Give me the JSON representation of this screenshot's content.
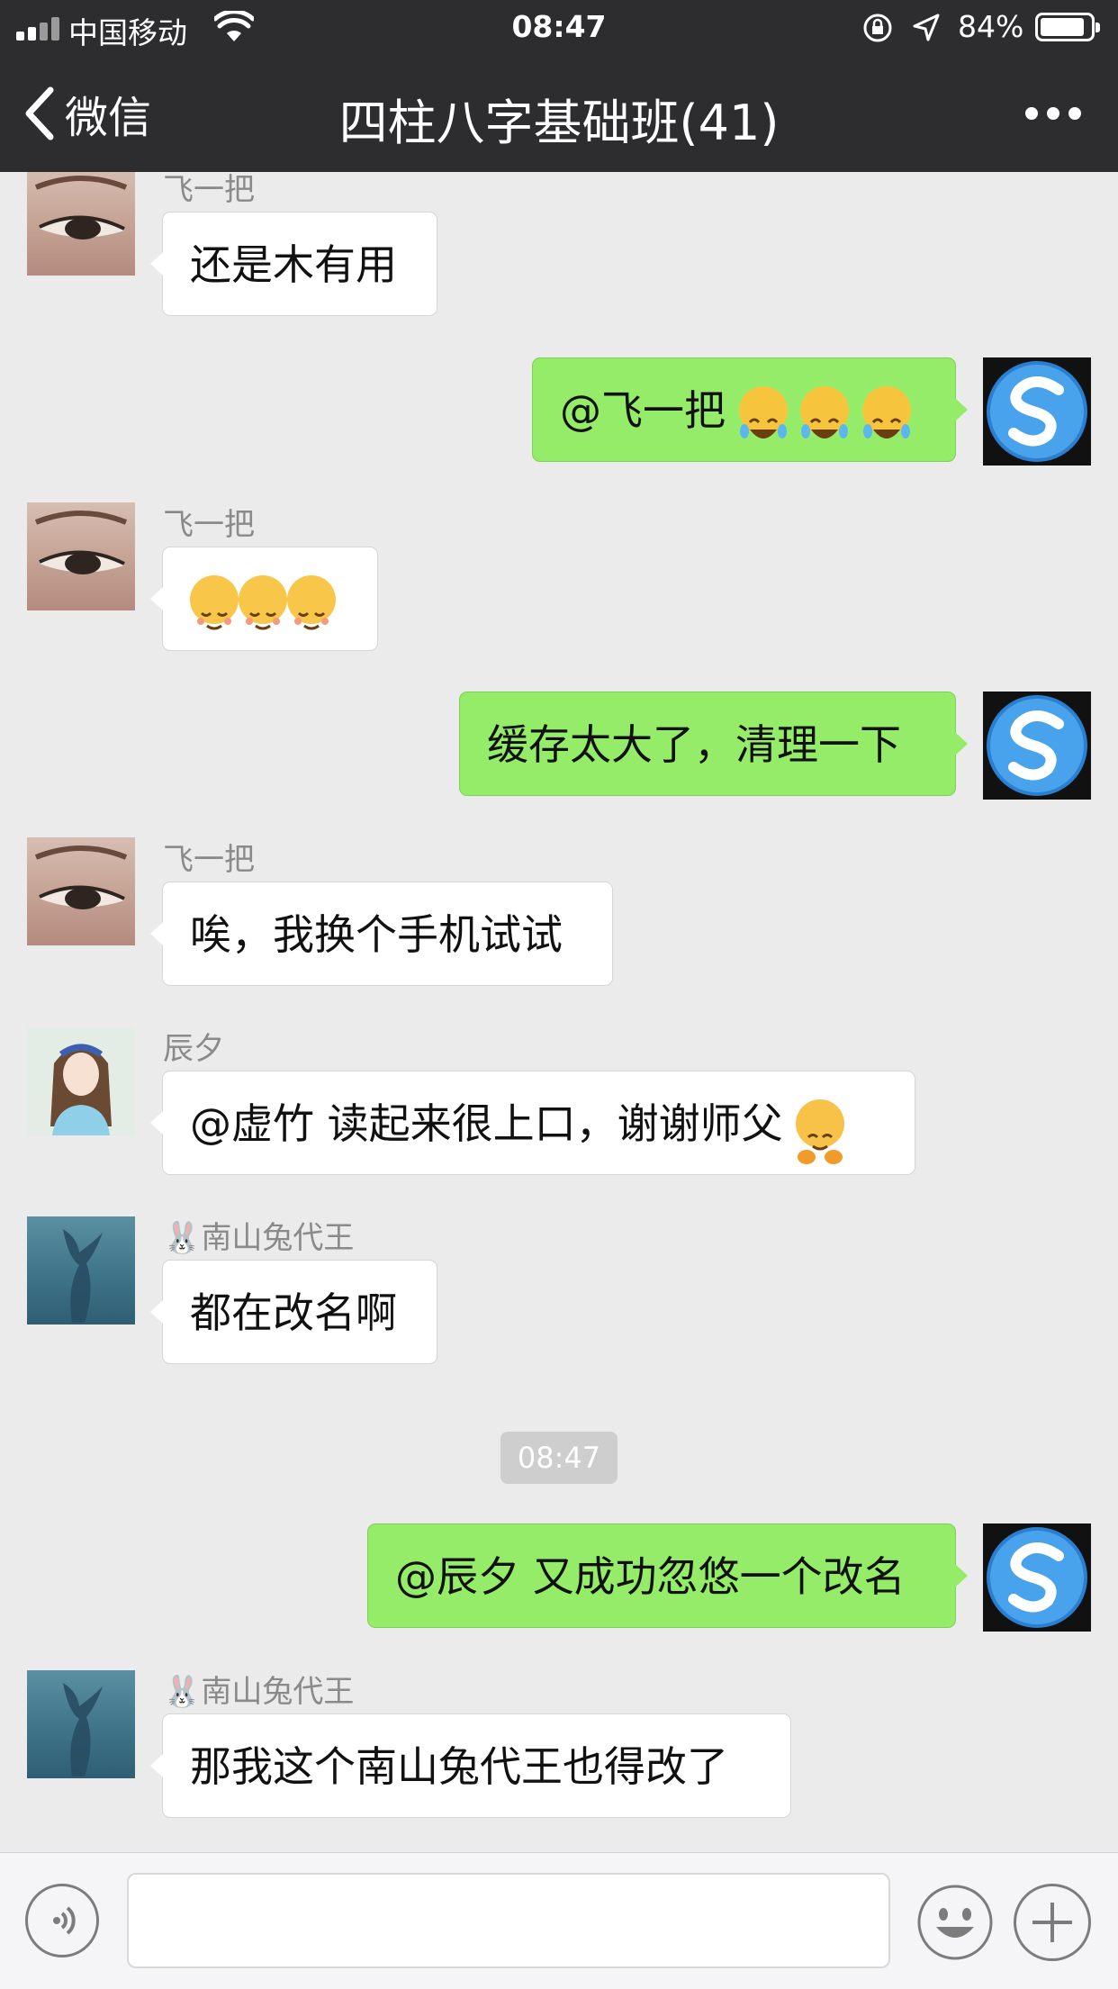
{
  "status_bar": {
    "carrier": "中国移动",
    "time": "08:47",
    "battery_percent": "84%",
    "battery_level": 0.84
  },
  "nav": {
    "back_label": "微信",
    "title": "四柱八字基础班(41)"
  },
  "messages": [
    {
      "side": "in",
      "sender": "飞一把",
      "text": "还是木有用"
    },
    {
      "side": "out",
      "text": "@飞一把 ",
      "emoji": "face-with-tears-of-joy x3"
    },
    {
      "side": "in",
      "sender": "飞一把",
      "emoji": "relieved-face x3"
    },
    {
      "side": "out",
      "text": "缓存太大了，清理一下"
    },
    {
      "side": "in",
      "sender": "飞一把",
      "text": "唉，我换个手机试试"
    },
    {
      "side": "in",
      "sender": "辰夕",
      "text": "@虚竹  读起来很上口，谢谢师父",
      "emoji": "hugging-face"
    },
    {
      "side": "in",
      "sender": "🐰南山兔代王",
      "text": "都在改名啊"
    },
    {
      "timestamp": "08:47"
    },
    {
      "side": "out",
      "text": "@辰夕 又成功忽悠一个改名"
    },
    {
      "side": "in",
      "sender": "🐰南山兔代王",
      "text": "那我这个南山兔代王也得改了"
    }
  ],
  "input_bar": {
    "value": ""
  },
  "colors": {
    "nav_bg": "#2d2d2f",
    "chat_bg": "#ebebeb",
    "out_bubble": "#95ec69",
    "in_bubble": "#ffffff"
  }
}
